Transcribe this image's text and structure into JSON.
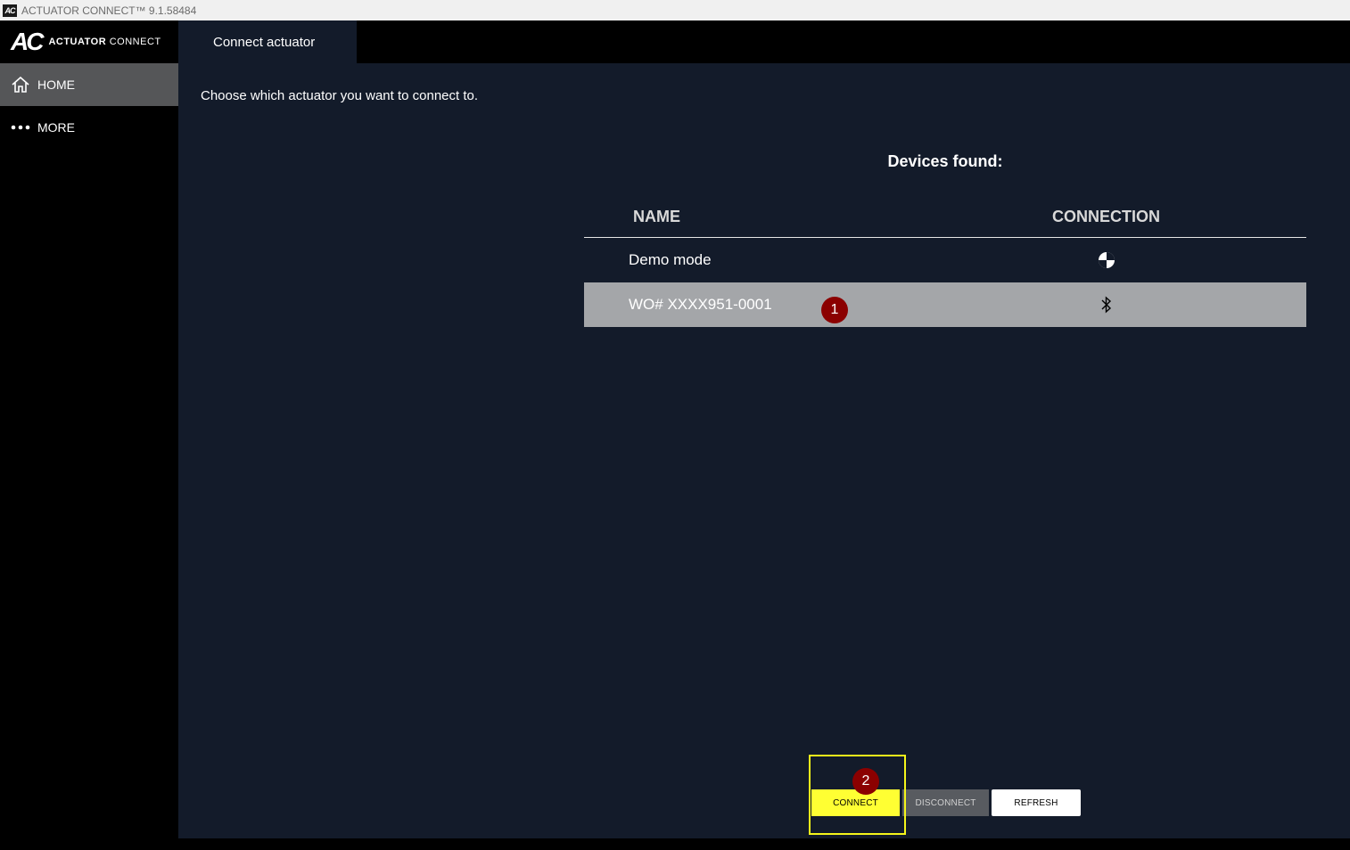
{
  "window": {
    "icon_text": "AC",
    "title": "ACTUATOR CONNECT™ 9.1.58484"
  },
  "sidebar": {
    "logo": {
      "mark": "AC",
      "text_bold": "ACTUATOR",
      "text_light": "CONNECT"
    },
    "items": [
      {
        "label": "HOME",
        "icon": "home-icon",
        "active": true
      },
      {
        "label": "MORE",
        "icon": "more-dots-icon",
        "active": false
      }
    ]
  },
  "header": {
    "tab_label": "Connect actuator"
  },
  "main": {
    "instruction": "Choose which actuator you want to connect to.",
    "devices_title": "Devices found:",
    "table": {
      "columns": [
        "NAME",
        "CONNECTION"
      ],
      "rows": [
        {
          "name": "Demo mode",
          "connection_icon": "demo-icon",
          "selected": false
        },
        {
          "name": "WO# XXXX951-0001",
          "connection_icon": "bluetooth-icon",
          "selected": true
        }
      ]
    },
    "markers": [
      "1",
      "2"
    ],
    "buttons": {
      "connect": "CONNECT",
      "disconnect": "DISCONNECT",
      "refresh": "REFRESH"
    }
  },
  "colors": {
    "background": "#131b2a",
    "sidebar": "#000000",
    "active_nav": "#555658",
    "selected_row": "#a4a6a9",
    "connect_button": "#ffff33",
    "highlight": "#f5f51a",
    "marker": "#8b0000"
  }
}
